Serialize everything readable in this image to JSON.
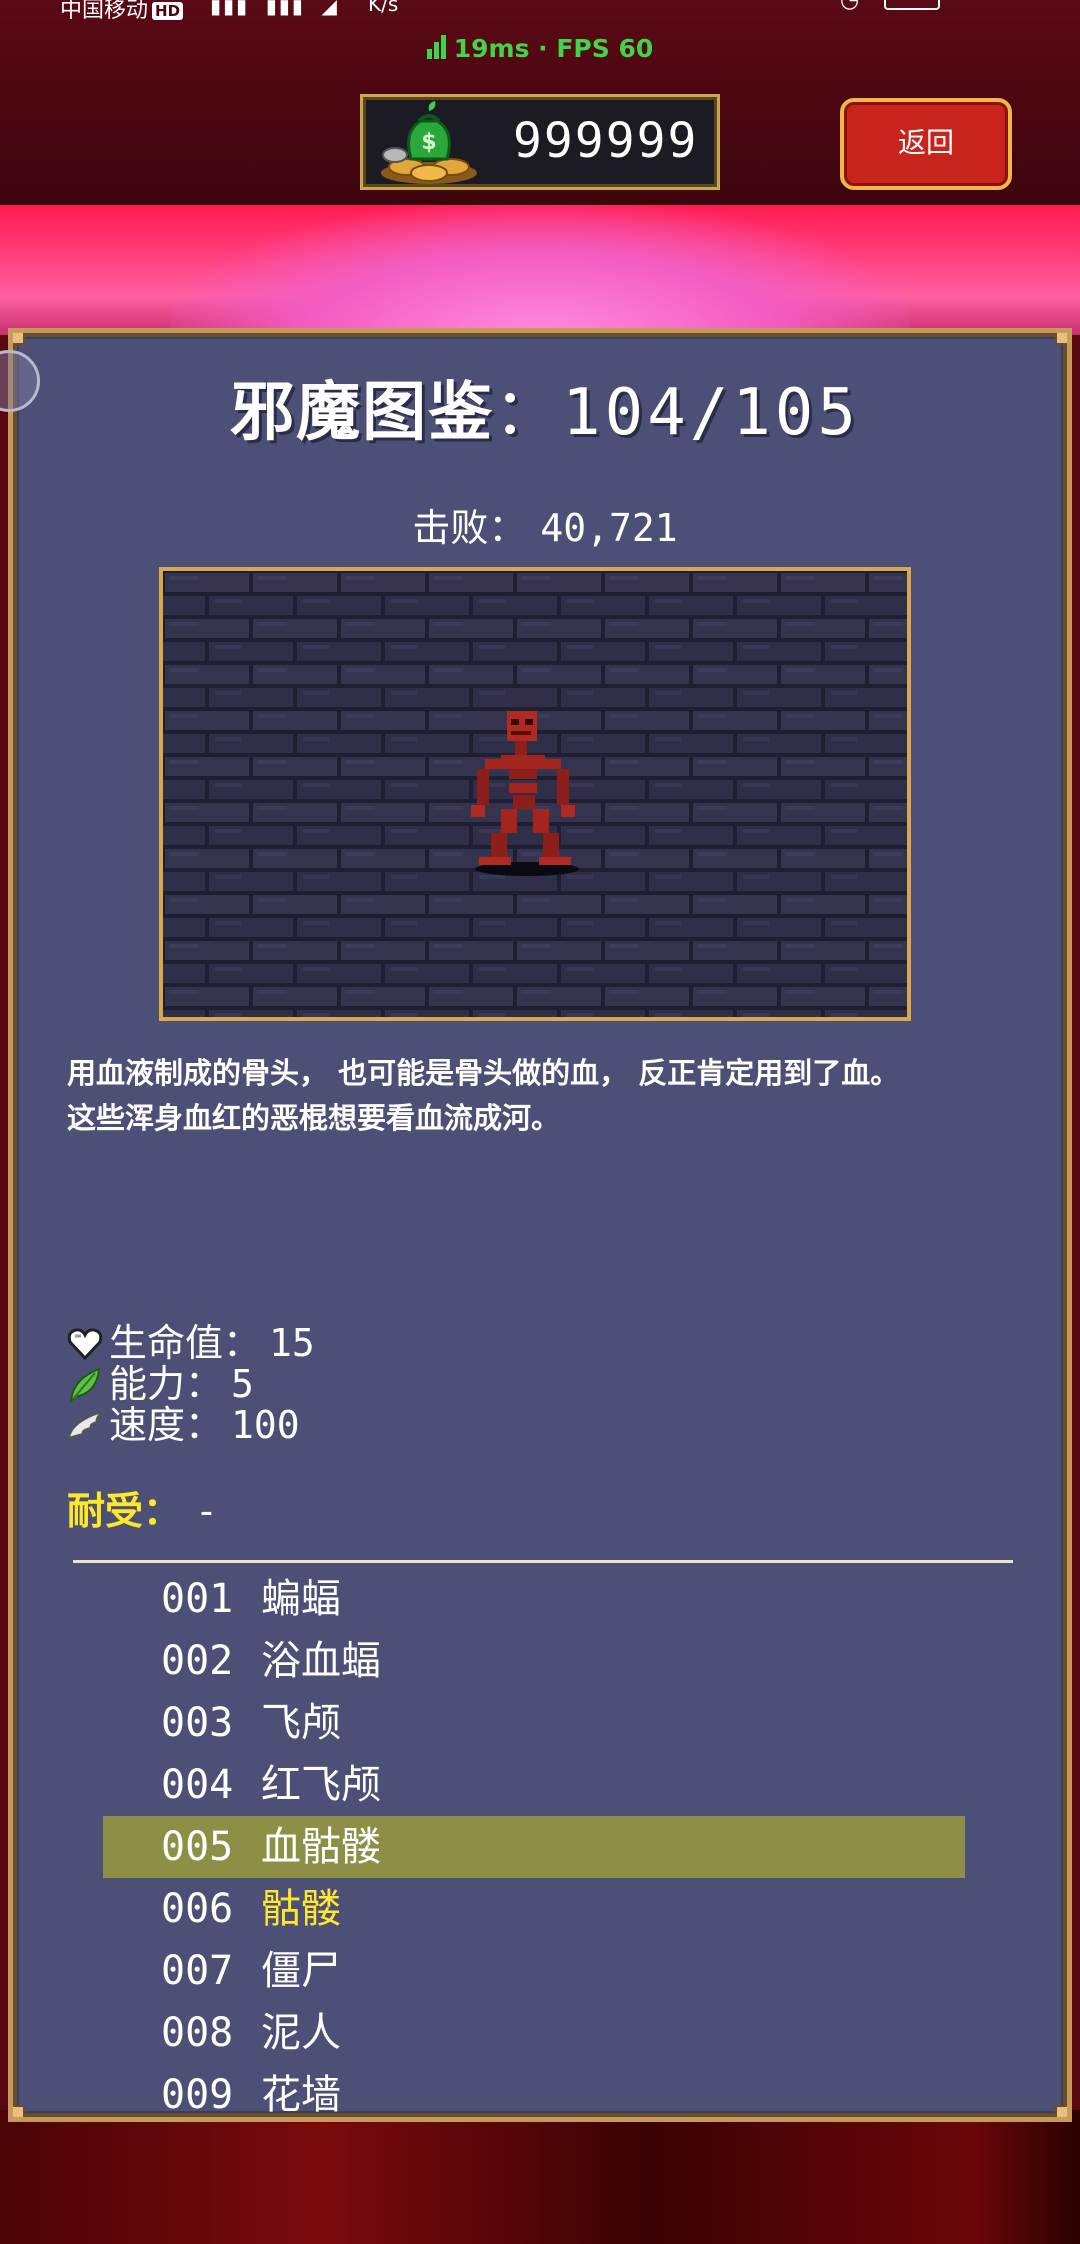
{
  "status_bar": {
    "carrier": "中国移动",
    "hd": "HD",
    "netspeed": "K/s"
  },
  "ping": {
    "text": "19ms · FPS 60",
    "color": "#3fd44a"
  },
  "currency": {
    "icon": "money-bag-coins-icon",
    "amount": "999999"
  },
  "back_button": {
    "label": "返回"
  },
  "bestiary": {
    "title": "邪魔图鉴",
    "count": "：104/105",
    "defeat_label": "击败：",
    "defeat_count": "40,721",
    "monster_sprite": "blood-skeleton-sprite",
    "description": [
      "用血液制成的骨头， 也可能是骨头做的血， 反正肯定用到了血。",
      "这些浑身血红的恶棍想要看血流成河。"
    ],
    "stats": [
      {
        "icon": "heart-icon",
        "label": "生命值",
        "value": "15"
      },
      {
        "icon": "leaf-icon",
        "label": "能力",
        "value": "5"
      },
      {
        "icon": "wing-icon",
        "label": "速度",
        "value": "100"
      }
    ],
    "resist_label": "耐受：",
    "resist_value": "-"
  },
  "monster_list": [
    {
      "no": "001",
      "name": "蝙蝠"
    },
    {
      "no": "002",
      "name": "浴血蝠"
    },
    {
      "no": "003",
      "name": "飞颅"
    },
    {
      "no": "004",
      "name": "红飞颅"
    },
    {
      "no": "005",
      "name": "血骷髅",
      "selected": true
    },
    {
      "no": "006",
      "name": "骷髅",
      "highlight": "yellow"
    },
    {
      "no": "007",
      "name": "僵尸"
    },
    {
      "no": "008",
      "name": "泥人"
    },
    {
      "no": "009",
      "name": "花墙"
    }
  ],
  "colors": {
    "panel": "#4c5076",
    "frame_gold": "#c69a5a",
    "selected_row": "#8e8f46",
    "highlight_text": "#ffe82a",
    "back_button": "#c8241c"
  }
}
